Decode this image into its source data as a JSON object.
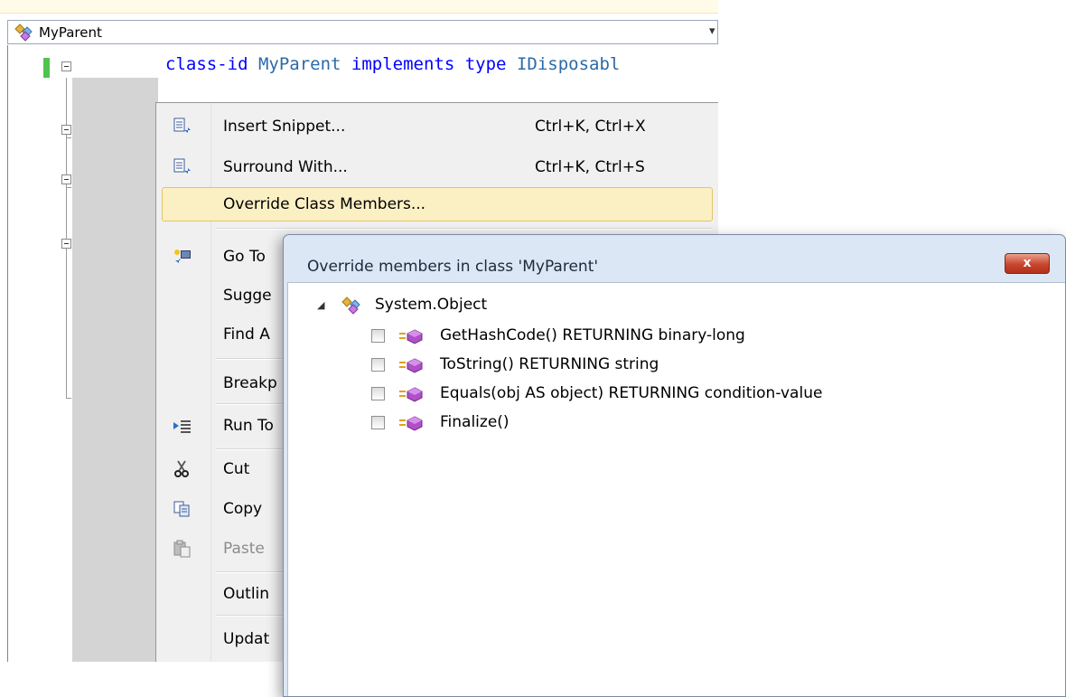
{
  "editor": {
    "nav_class": "MyParent",
    "nav_dropdown_glyph": "▾",
    "code": {
      "kw1": "class-id",
      "name": " MyParent ",
      "kw2": "implements type",
      "type": " IDisposabl"
    }
  },
  "context_menu": {
    "items": [
      {
        "label": "Insert Snippet...",
        "shortcut": "Ctrl+K, Ctrl+X",
        "icon": "snippet-icon"
      },
      {
        "label": "Surround With...",
        "shortcut": "Ctrl+K, Ctrl+S",
        "icon": "surround-icon"
      },
      {
        "label": "Override Class Members...",
        "shortcut": "",
        "icon": "",
        "highlighted": true
      },
      {
        "label": "Go To",
        "icon": "goto-definition-icon"
      },
      {
        "label": "Sugge"
      },
      {
        "label": "Find A"
      },
      {
        "label": "Breakp"
      },
      {
        "label": "Run To",
        "icon": "run-to-cursor-icon"
      },
      {
        "label": "Cut",
        "icon": "scissors-icon"
      },
      {
        "label": "Copy",
        "icon": "copy-icon"
      },
      {
        "label": "Paste",
        "icon": "paste-icon",
        "disabled": true
      },
      {
        "label": "Outlin"
      },
      {
        "label": "Updat"
      }
    ]
  },
  "dialog": {
    "title": "Override members in class 'MyParent'",
    "close_label": "x",
    "root": {
      "label": "System.Object",
      "expanded": true
    },
    "members": [
      {
        "label": "GetHashCode() RETURNING binary-long",
        "checked": false
      },
      {
        "label": "ToString() RETURNING string",
        "checked": false
      },
      {
        "label": "Equals(obj AS object) RETURNING condition-value",
        "checked": false
      },
      {
        "label": "Finalize()",
        "checked": false
      }
    ]
  },
  "colors": {
    "keyword": "#0000ff",
    "identifier": "#2b6aa8",
    "menu_highlight": "#fbf0c4",
    "close_button": "#c8452e",
    "method_icon": "#b04fc7"
  }
}
